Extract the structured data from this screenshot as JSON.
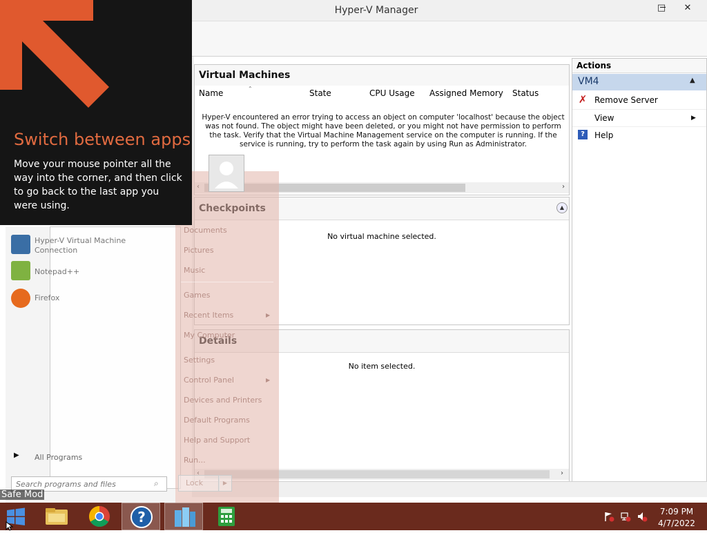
{
  "window": {
    "title": "Hyper-V Manager",
    "controls": {
      "minimize": "─",
      "maximize": "□",
      "close": "✕"
    }
  },
  "virtual_machines": {
    "heading": "Virtual Machines",
    "columns": [
      "Name",
      "State",
      "CPU Usage",
      "Assigned Memory",
      "Status"
    ],
    "error": "Hyper-V encountered an error trying to access an object on computer 'localhost' because the object was not found. The object might have been deleted, or you might not have permission to perform the task. Verify that the Virtual Machine Management service on the computer is running. If the service is running, try to perform the task again by using Run as Administrator."
  },
  "checkpoints": {
    "heading": "Checkpoints",
    "message": "No virtual machine selected."
  },
  "details": {
    "heading": "Details",
    "message": "No item selected."
  },
  "actions": {
    "heading": "Actions",
    "group": "VM4",
    "items": [
      {
        "label": "Remove Server",
        "icon": "remove-server-icon"
      },
      {
        "label": "View",
        "icon": "none"
      },
      {
        "label": "Help",
        "icon": "help-icon"
      }
    ]
  },
  "start_menu": {
    "programs": [
      {
        "label": "Hyper-V Virtual Machine Connection",
        "icon": "hyperv-vm-icon"
      },
      {
        "label": "Notepad++",
        "icon": "notepadpp-icon"
      },
      {
        "label": "Firefox",
        "icon": "firefox-icon"
      }
    ],
    "all_programs": "All Programs",
    "search_placeholder": "Search programs and files",
    "links": [
      "Documents",
      "Pictures",
      "Music",
      "Games",
      "Recent Items",
      "My Computer",
      "Settings",
      "Control Panel",
      "Devices and Printers",
      "Default Programs",
      "Help and Support",
      "Run..."
    ],
    "lock": "Lock"
  },
  "tip": {
    "title": "Switch between apps",
    "body": "Move your mouse pointer all the way into the corner, and then click to go back to the last app you were using."
  },
  "safe_mode": "Safe Mod",
  "taskbar": {
    "apps": [
      "start-icon",
      "file-explorer-icon",
      "chrome-icon",
      "help-icon",
      "server-manager-icon",
      "calculator-icon"
    ],
    "time": "7:09 PM",
    "date": "4/7/2022"
  },
  "colors": {
    "accent": "#e06a40",
    "taskbar": "#6a2a1d",
    "selection": "#c6d7ec"
  }
}
